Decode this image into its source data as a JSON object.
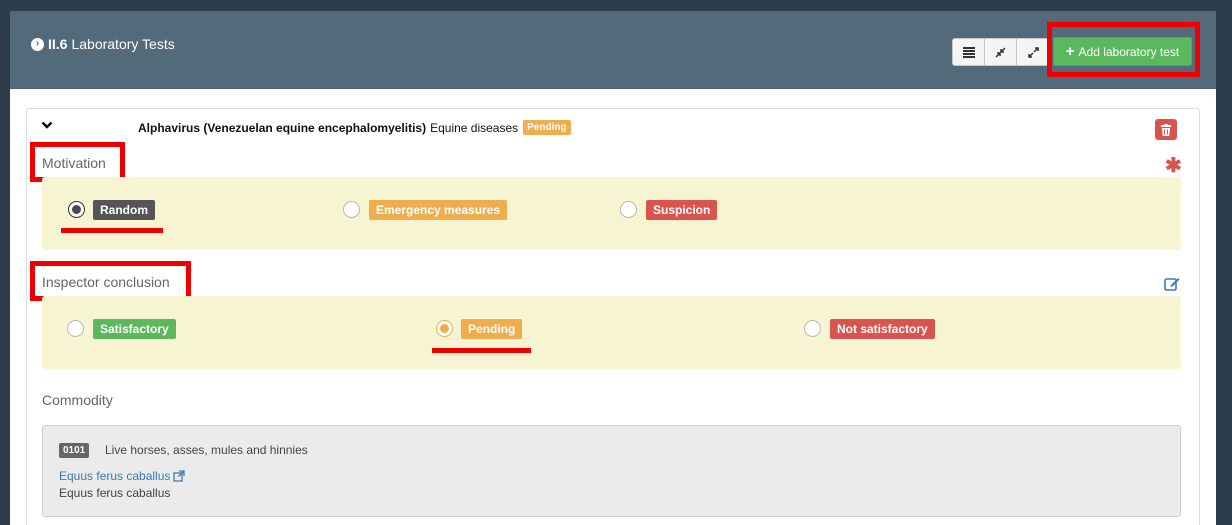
{
  "section": {
    "number": "II.6",
    "title": "Laboratory Tests"
  },
  "toolbar": {
    "view_icons": [
      "list-icon",
      "compress-icon",
      "expand-icon"
    ],
    "add_label": "Add laboratory test"
  },
  "test": {
    "disease_name": "Alphavirus (Venezuelan equine encephalomyelitis)",
    "disease_category": "Equine diseases",
    "status_badge": "Pending"
  },
  "motivation": {
    "label": "Motivation",
    "options": [
      {
        "label": "Random",
        "color": "#555555",
        "selected": true
      },
      {
        "label": "Emergency measures",
        "color": "#f0ad4e",
        "selected": false
      },
      {
        "label": "Suspicion",
        "color": "#d9534f",
        "selected": false
      }
    ]
  },
  "inspector_conclusion": {
    "label": "Inspector conclusion",
    "options": [
      {
        "label": "Satisfactory",
        "color": "#5cb85c",
        "selected": false
      },
      {
        "label": "Pending",
        "color": "#f0ad4e",
        "selected": true
      },
      {
        "label": "Not satisfactory",
        "color": "#d9534f",
        "selected": false
      }
    ]
  },
  "commodity": {
    "label": "Commodity",
    "code": "0101",
    "description": "Live horses, asses, mules and hinnies",
    "species_link": "Equus ferus caballus",
    "species_text": "Equus ferus caballus"
  },
  "colors": {
    "header": "#536a7b",
    "highlight": "#ee0000",
    "panel": "#f7f4d2"
  }
}
